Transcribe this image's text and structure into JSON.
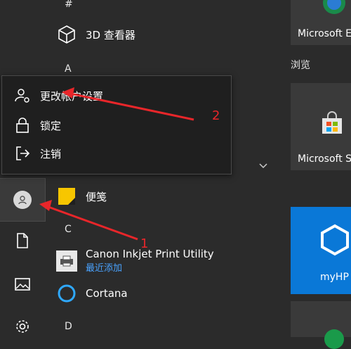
{
  "app_list": {
    "headers": {
      "hash": "#",
      "a": "A",
      "c": "C",
      "d": "D"
    },
    "items": [
      {
        "name": "3D 查看器",
        "icon": "cube-icon"
      },
      {
        "name": "便笺",
        "icon": "sticky-note-icon"
      },
      {
        "name": "Canon Inkjet Print Utility",
        "sub": "最近添加",
        "icon": "printer-icon"
      },
      {
        "name": "Cortana",
        "icon": "cortana-ring-icon"
      }
    ]
  },
  "user_flyout": {
    "items": [
      {
        "label": "更改帐户设置",
        "icon": "user-settings-icon"
      },
      {
        "label": "锁定",
        "icon": "lock-icon"
      },
      {
        "label": "注销",
        "icon": "sign-out-icon"
      }
    ]
  },
  "tiles": {
    "section_browse": "浏览",
    "edge_label": "Microsoft E",
    "store_label": "Microsoft S",
    "myhp_label": "myHP"
  },
  "rail": {
    "user_icon": "user-avatar-icon",
    "documents_icon": "document-icon",
    "pictures_icon": "pictures-icon",
    "settings_icon": "gear-icon"
  },
  "annotations": {
    "one": "1",
    "two": "2"
  },
  "colors": {
    "accent": "#0a78d7",
    "annotation": "#e8262a",
    "link": "#4aa3ff"
  }
}
